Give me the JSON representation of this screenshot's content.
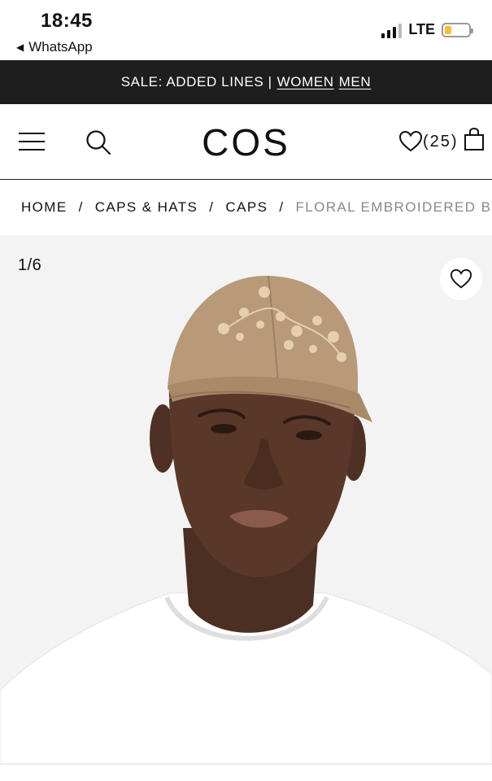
{
  "status_bar": {
    "time": "18:45",
    "back_app": "WhatsApp",
    "network": "LTE",
    "battery_level": 0.3,
    "battery_color": "#f2c12e"
  },
  "promo": {
    "text": "SALE: ADDED LINES |",
    "link_women": "WOMEN",
    "link_men": "MEN"
  },
  "header": {
    "logo": "COS",
    "wishlist_count": "(25)",
    "icons": [
      "menu-icon",
      "search-icon",
      "heart-icon",
      "bag-icon"
    ]
  },
  "breadcrumb": {
    "items": [
      "HOME",
      "CAPS & HATS",
      "CAPS",
      "FLORAL EMBROIDERED B"
    ],
    "separator": "/"
  },
  "gallery": {
    "counter": "1/6",
    "background": "#f3f3f3",
    "image": "product-photo-man-wearing-beige-floral-embroidered-cap"
  },
  "colors": {
    "promo_bg": "#1e1e1e",
    "cap": "#b89a78",
    "text": "#111111",
    "muted": "#888888"
  }
}
